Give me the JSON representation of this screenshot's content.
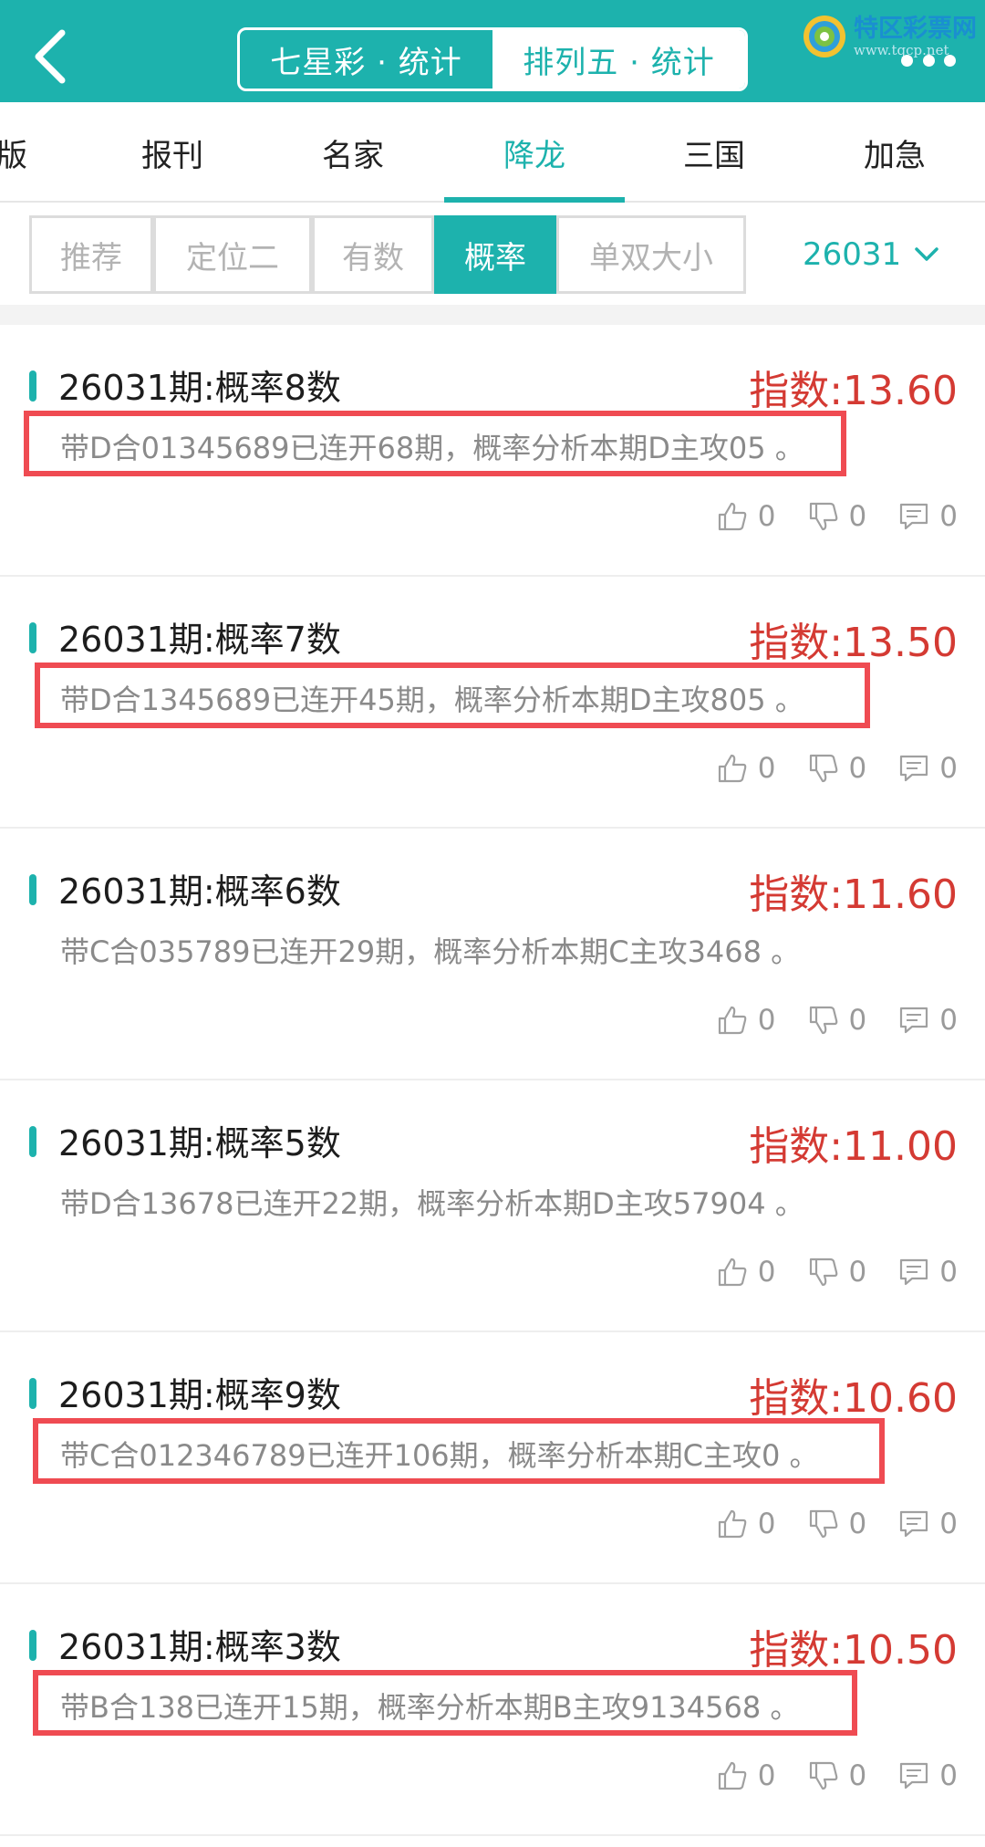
{
  "header": {
    "segments": [
      {
        "label": "七星彩 · 统计",
        "active": false
      },
      {
        "label": "排列五 · 统计",
        "active": true
      }
    ],
    "logo_text": "特区彩票网",
    "logo_url": "www.tqcp.net"
  },
  "tabs": [
    {
      "label": "版"
    },
    {
      "label": "报刊"
    },
    {
      "label": "名家"
    },
    {
      "label": "降龙"
    },
    {
      "label": "三国"
    },
    {
      "label": "加急"
    }
  ],
  "filters": [
    {
      "label": "推荐"
    },
    {
      "label": "定位二"
    },
    {
      "label": "有数"
    },
    {
      "label": "概率"
    },
    {
      "label": "单双大小"
    }
  ],
  "period": "26031",
  "posts": [
    {
      "title": "26031期:概率8数",
      "index": "指数:13.60",
      "desc": "带D合01345689已连开68期，概率分析本期D主攻05 。",
      "likes": "0",
      "dislikes": "0",
      "comments": "0"
    },
    {
      "title": "26031期:概率7数",
      "index": "指数:13.50",
      "desc": "带D合1345689已连开45期，概率分析本期D主攻805 。",
      "likes": "0",
      "dislikes": "0",
      "comments": "0"
    },
    {
      "title": "26031期:概率6数",
      "index": "指数:11.60",
      "desc": "带C合035789已连开29期，概率分析本期C主攻3468 。",
      "likes": "0",
      "dislikes": "0",
      "comments": "0"
    },
    {
      "title": "26031期:概率5数",
      "index": "指数:11.00",
      "desc": "带D合13678已连开22期，概率分析本期D主攻57904 。",
      "likes": "0",
      "dislikes": "0",
      "comments": "0"
    },
    {
      "title": "26031期:概率9数",
      "index": "指数:10.60",
      "desc": "带C合012346789已连开106期，概率分析本期C主攻0 。",
      "likes": "0",
      "dislikes": "0",
      "comments": "0"
    },
    {
      "title": "26031期:概率3数",
      "index": "指数:10.50",
      "desc": "带B合138已连开15期，概率分析本期B主攻9134568 。",
      "likes": "0",
      "dislikes": "0",
      "comments": "0"
    }
  ],
  "colors": {
    "accent": "#1db2ad",
    "index_red": "#d43a33",
    "highlight_box": "#ef4b52"
  }
}
